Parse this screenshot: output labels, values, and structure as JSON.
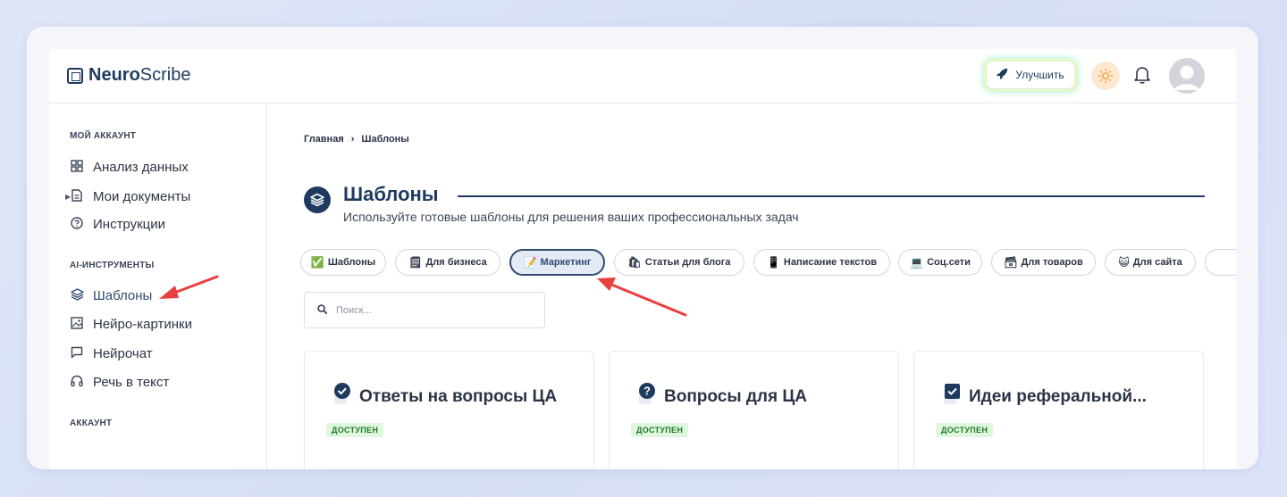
{
  "header": {
    "logo_bold": "Neuro",
    "logo_rest": "Scribe",
    "upgrade_label": "Улучшить"
  },
  "sidebar": {
    "sections": [
      {
        "title": "МОЙ АККАУНТ"
      },
      {
        "title": "AI-ИНСТРУМЕНТЫ"
      },
      {
        "title": "АККАУНТ"
      }
    ],
    "items": [
      {
        "label": "Анализ данных",
        "icon": "grid-icon"
      },
      {
        "label": "Мои документы",
        "icon": "document-icon"
      },
      {
        "label": "Инструкции",
        "icon": "help-circle-icon"
      },
      {
        "label": "Шаблоны",
        "icon": "layers-icon",
        "active": true
      },
      {
        "label": "Нейро-картинки",
        "icon": "image-icon"
      },
      {
        "label": "Нейрочат",
        "icon": "chat-icon"
      },
      {
        "label": "Речь в текст",
        "icon": "headphones-icon"
      }
    ]
  },
  "breadcrumb": {
    "home": "Главная",
    "separator": "›",
    "current": "Шаблоны"
  },
  "page": {
    "title": "Шаблоны",
    "subtitle": "Используйте готовые шаблоны для решения ваших профессиональных задач"
  },
  "chips": [
    {
      "label": "Шаблоны",
      "icon": "✅"
    },
    {
      "label": "Для бизнеса",
      "icon": "🗒"
    },
    {
      "label": "Маркетинг",
      "icon": "📝",
      "active": true
    },
    {
      "label": "Статьи для блога",
      "icon": "🛍"
    },
    {
      "label": "Написание текстов",
      "icon": "📱"
    },
    {
      "label": "Соц.сети",
      "icon": "💻"
    },
    {
      "label": "Для товаров",
      "icon": "🗃"
    },
    {
      "label": "Для сайта",
      "icon": "😺"
    }
  ],
  "search": {
    "placeholder": "Поиск..."
  },
  "cards": [
    {
      "title": "Ответы на вопросы ЦА",
      "badge": "ДОСТУПЕН",
      "icon": "check-circle-icon"
    },
    {
      "title": "Вопросы для ЦА",
      "badge": "ДОСТУПЕН",
      "icon": "question-circle-icon"
    },
    {
      "title": "Идеи реферальной...",
      "badge": "ДОСТУПЕН",
      "icon": "checkbox-icon"
    }
  ],
  "colors": {
    "accent": "#1e3a5f",
    "annotation_arrow": "#e8403e",
    "badge_bg": "#dff7dd"
  }
}
